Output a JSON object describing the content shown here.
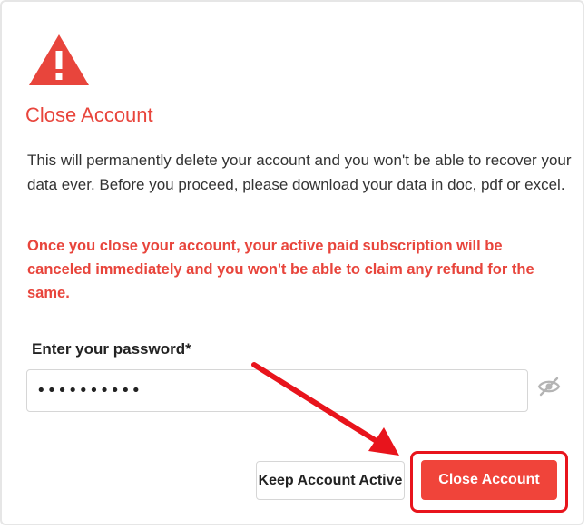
{
  "dialog": {
    "title": "Close Account",
    "description": "This will permanently delete your account and you won't be able to recover your data ever. Before you proceed, please download your data in doc, pdf or excel.",
    "warning": "Once you close your account, your active paid subscription will be canceled immediately and you won't be able to claim any refund for the same.",
    "password_label": "Enter your password*",
    "password_value": "••••••••••",
    "keep_button_label": "Keep Account Active",
    "close_button_label": "Close Account"
  },
  "icons": {
    "warning": "warning-triangle-icon",
    "visibility": "eye-slash-icon"
  },
  "colors": {
    "accent": "#e8453c",
    "button": "#f0443a",
    "annotation": "#e8141c"
  }
}
